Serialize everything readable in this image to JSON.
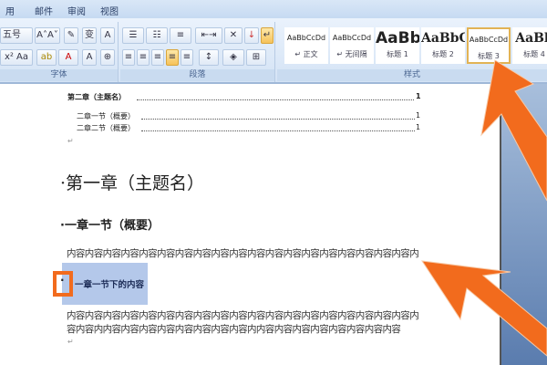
{
  "tabs": [
    "用",
    "邮件",
    "审阅",
    "视图"
  ],
  "font_group": {
    "size": "五号",
    "label": "字体"
  },
  "para_group": {
    "label": "段落"
  },
  "styles": {
    "label": "样式",
    "items": [
      {
        "preview": "AaBbCcDd",
        "name": "↵ 正文"
      },
      {
        "preview": "AaBbCcDd",
        "name": "↵ 无间隔"
      },
      {
        "preview": "AaBb",
        "name": "标题 1"
      },
      {
        "preview": "AaBbC",
        "name": "标题 2"
      },
      {
        "preview": "AaBbCcDd",
        "name": "标题 3"
      },
      {
        "preview": "AaBb",
        "name": "标题 4"
      }
    ]
  },
  "toc": [
    {
      "text": "第二章（主题名）",
      "page": "1"
    },
    {
      "text": "二章一节（概要）",
      "page": "1"
    },
    {
      "text": "二章二节（概要）",
      "page": "1"
    }
  ],
  "doc": {
    "h1": "第一章（主题名）",
    "h2": "一章一节（概要）",
    "line1": "内容内容内容内容内容内容内容内容内容内容内容内容内容内容内容内容内容内容内容内",
    "selected": "一章一节下的内容",
    "line2": "内容内容内容内容内容内容内容内容内容内容内容内容内容内容内容内容内容内容内容内",
    "line3": "容内容内内容内容内容内容内容内容内容内容内内容内容内容内容内容内容内容内容",
    "para_mark": "↵"
  },
  "accent": "#f26b1d"
}
